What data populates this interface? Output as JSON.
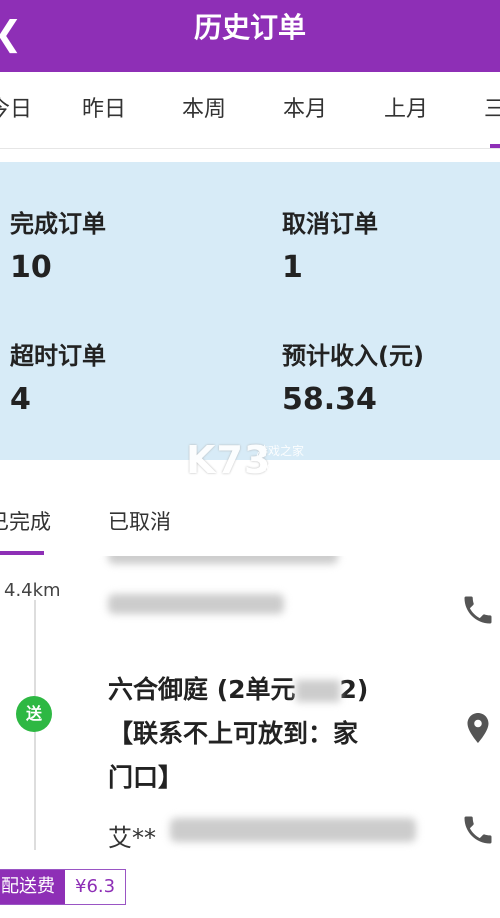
{
  "header": {
    "title": "历史订单"
  },
  "tabs": [
    "今日",
    "昨日",
    "本周",
    "本月",
    "上月",
    "三"
  ],
  "stats": {
    "completed": {
      "label": "完成订单",
      "value": "10"
    },
    "cancelled": {
      "label": "取消订单",
      "value": "1"
    },
    "overtime": {
      "label": "超时订单",
      "value": "4"
    },
    "income": {
      "label": "预计收入(元)",
      "value": "58.34"
    }
  },
  "watermark": {
    "logo": "K73",
    "cn": "游戏之家",
    "url": ".com"
  },
  "subtabs": {
    "done": "已完成",
    "cancelled": "已取消"
  },
  "order": {
    "distance": "4.4km",
    "deliver_badge": "送",
    "address_line1": "六合御庭 (2单元",
    "address_suffix": "2)",
    "address_line2": "【联系不上可放到：家",
    "address_line3": "门口】",
    "customer_name": "艾**",
    "fee_label": "配送费",
    "fee_value": "¥6.3"
  },
  "colors": {
    "brand": "#8e2fb6",
    "stats_bg": "#d7ebf7",
    "deliver_green": "#2eb843"
  }
}
